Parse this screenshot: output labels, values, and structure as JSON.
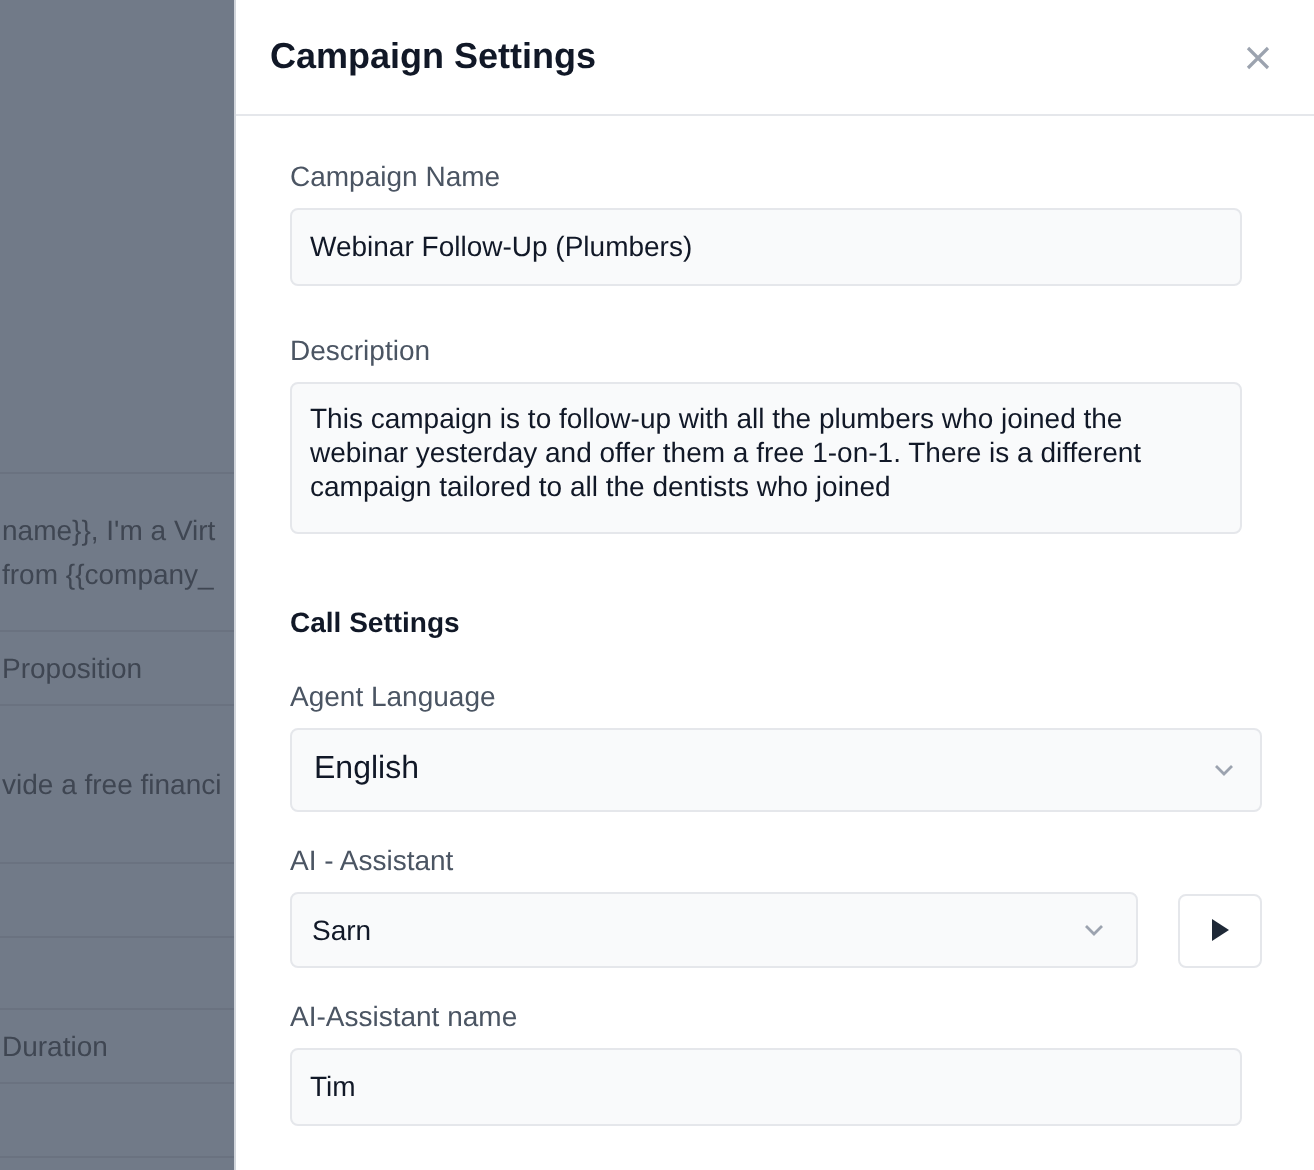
{
  "background_page": {
    "rows": [
      {
        "texts": []
      },
      {
        "texts": [
          "name}}, I'm a Virt",
          "from {{company_"
        ]
      },
      {
        "texts": [
          "Proposition"
        ]
      },
      {
        "texts": [
          "vide a free financi"
        ]
      },
      {
        "texts": []
      },
      {
        "texts": []
      },
      {
        "texts": [
          "Duration"
        ]
      },
      {
        "texts": []
      }
    ]
  },
  "panel": {
    "title": "Campaign Settings",
    "fields": [
      {
        "kind": "input",
        "label": "Campaign Name",
        "value": "Webinar Follow-Up (Plumbers)"
      },
      {
        "kind": "textarea",
        "label": "Description",
        "value": "This campaign is to follow-up with all the plumbers who joined the webinar yesterday and offer them a free 1-on-1. There is a different campaign tailored to all the dentists who joined"
      },
      {
        "kind": "section",
        "label": "Call Settings"
      },
      {
        "kind": "select",
        "label": "Agent Language",
        "value": "English"
      },
      {
        "kind": "select_play",
        "label": "AI - Assistant",
        "value": "Sarn"
      },
      {
        "kind": "input",
        "label": "AI-Assistant name",
        "value": "Tim"
      }
    ]
  }
}
